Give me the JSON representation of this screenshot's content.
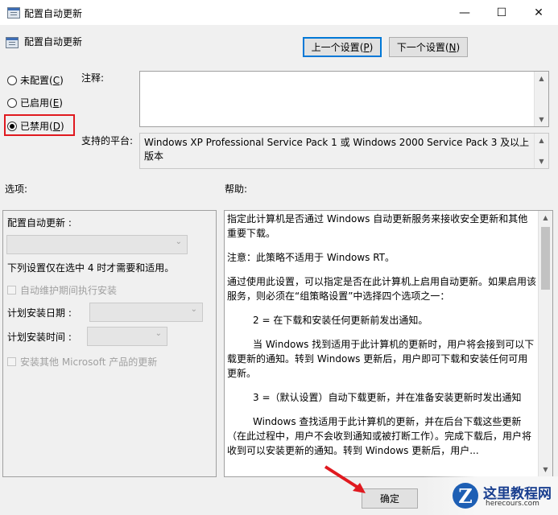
{
  "window": {
    "title": "配置自动更新",
    "minimize": "—",
    "maximize": "☐",
    "close": "✕"
  },
  "setting_name": "配置自动更新",
  "nav": {
    "prev_label": "上一个设置",
    "prev_key": "P",
    "next_label": "下一个设置",
    "next_key": "N"
  },
  "radios": [
    {
      "label": "未配置",
      "key": "C",
      "checked": false
    },
    {
      "label": "已启用",
      "key": "E",
      "checked": false
    },
    {
      "label": "已禁用",
      "key": "D",
      "checked": true
    }
  ],
  "comment": {
    "label": "注释:",
    "value": ""
  },
  "supported": {
    "label": "支持的平台:",
    "value": "Windows XP Professional Service Pack 1 或 Windows 2000 Service Pack 3 及以上版本"
  },
  "options": {
    "header": "选项:",
    "configure_label": "配置自动更新 :",
    "configure_value": "",
    "note": "下列设置仅在选中 4 时才需要和适用。",
    "auto_maintenance": "自动维护期间执行安装",
    "schedule_day_label": "计划安装日期 :",
    "schedule_time_label": "计划安装时间 :",
    "install_other": "安装其他 Microsoft 产品的更新"
  },
  "help": {
    "header": "帮助:",
    "paragraphs": [
      "指定此计算机是否通过 Windows 自动更新服务来接收安全更新和其他重要下载。",
      "注意：此策略不适用于 Windows RT。",
      "通过使用此设置，可以指定是否在此计算机上启用自动更新。如果启用该服务，则必须在“组策略设置”中选择四个选项之一：",
      "2 = 在下载和安装任何更新前发出通知。",
      "当 Windows 找到适用于此计算机的更新时，用户将会接到可以下载更新的通知。转到 Windows 更新后，用户即可下载和安装任何可用更新。",
      "3 =（默认设置）自动下载更新，并在准备安装更新时发出通知",
      "Windows 查找适用于此计算机的更新，并在后台下载这些更新（在此过程中，用户不会收到通知或被打断工作）。完成下载后，用户将收到可以安装更新的通知。转到 Windows 更新后，用户..."
    ]
  },
  "footer": {
    "ok_label": "确定"
  },
  "watermark": {
    "logo_letter": "Z",
    "site_name": "这里教程网",
    "site_url": "herecours.com"
  },
  "colors": {
    "highlight_box": "#e0191f",
    "focus_border": "#0078d7"
  }
}
